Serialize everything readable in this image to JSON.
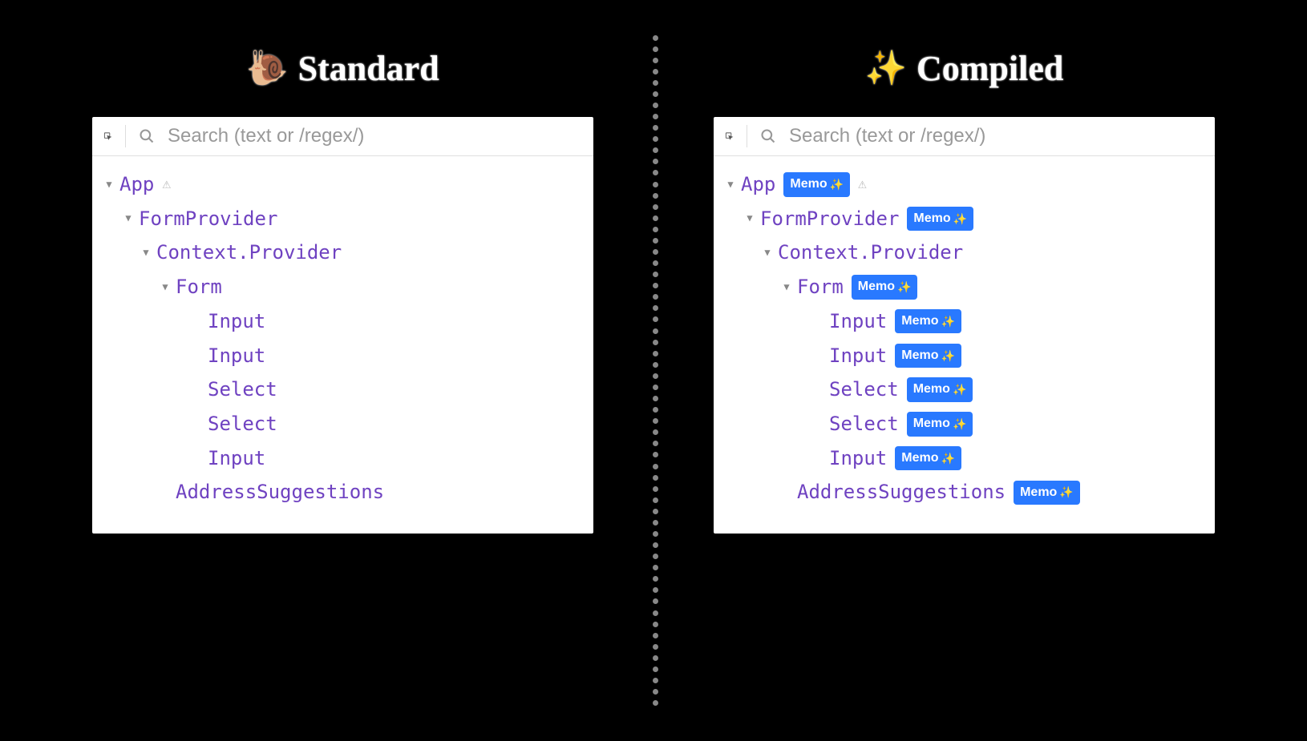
{
  "columns": {
    "standard": {
      "icon": "🐌",
      "title": "Standard"
    },
    "compiled": {
      "icon": "✨",
      "title": "Compiled"
    }
  },
  "search": {
    "placeholder": "Search (text or /regex/)"
  },
  "badge_label": "Memo",
  "standard_tree": [
    {
      "name": "App",
      "indent": 0,
      "disclosure": true,
      "warning": true,
      "badge": false
    },
    {
      "name": "FormProvider",
      "indent": 1,
      "disclosure": true,
      "warning": false,
      "badge": false
    },
    {
      "name": "Context.Provider",
      "indent": 2,
      "disclosure": true,
      "warning": false,
      "badge": false
    },
    {
      "name": "Form",
      "indent": 3,
      "disclosure": true,
      "warning": false,
      "badge": false
    },
    {
      "name": "Input",
      "indent": 4,
      "disclosure": false,
      "warning": false,
      "badge": false
    },
    {
      "name": "Input",
      "indent": 4,
      "disclosure": false,
      "warning": false,
      "badge": false
    },
    {
      "name": "Select",
      "indent": 4,
      "disclosure": false,
      "warning": false,
      "badge": false
    },
    {
      "name": "Select",
      "indent": 4,
      "disclosure": false,
      "warning": false,
      "badge": false
    },
    {
      "name": "Input",
      "indent": 4,
      "disclosure": false,
      "warning": false,
      "badge": false
    },
    {
      "name": "AddressSuggestions",
      "indent": 3,
      "disclosure": false,
      "warning": false,
      "badge": false
    }
  ],
  "compiled_tree": [
    {
      "name": "App",
      "indent": 0,
      "disclosure": true,
      "warning": true,
      "badge": true
    },
    {
      "name": "FormProvider",
      "indent": 1,
      "disclosure": true,
      "warning": false,
      "badge": true
    },
    {
      "name": "Context.Provider",
      "indent": 2,
      "disclosure": true,
      "warning": false,
      "badge": false
    },
    {
      "name": "Form",
      "indent": 3,
      "disclosure": true,
      "warning": false,
      "badge": true
    },
    {
      "name": "Input",
      "indent": 4,
      "disclosure": false,
      "warning": false,
      "badge": true
    },
    {
      "name": "Input",
      "indent": 4,
      "disclosure": false,
      "warning": false,
      "badge": true
    },
    {
      "name": "Select",
      "indent": 4,
      "disclosure": false,
      "warning": false,
      "badge": true
    },
    {
      "name": "Select",
      "indent": 4,
      "disclosure": false,
      "warning": false,
      "badge": true
    },
    {
      "name": "Input",
      "indent": 4,
      "disclosure": false,
      "warning": false,
      "badge": true
    },
    {
      "name": "AddressSuggestions",
      "indent": 3,
      "disclosure": false,
      "warning": false,
      "badge": true
    }
  ]
}
